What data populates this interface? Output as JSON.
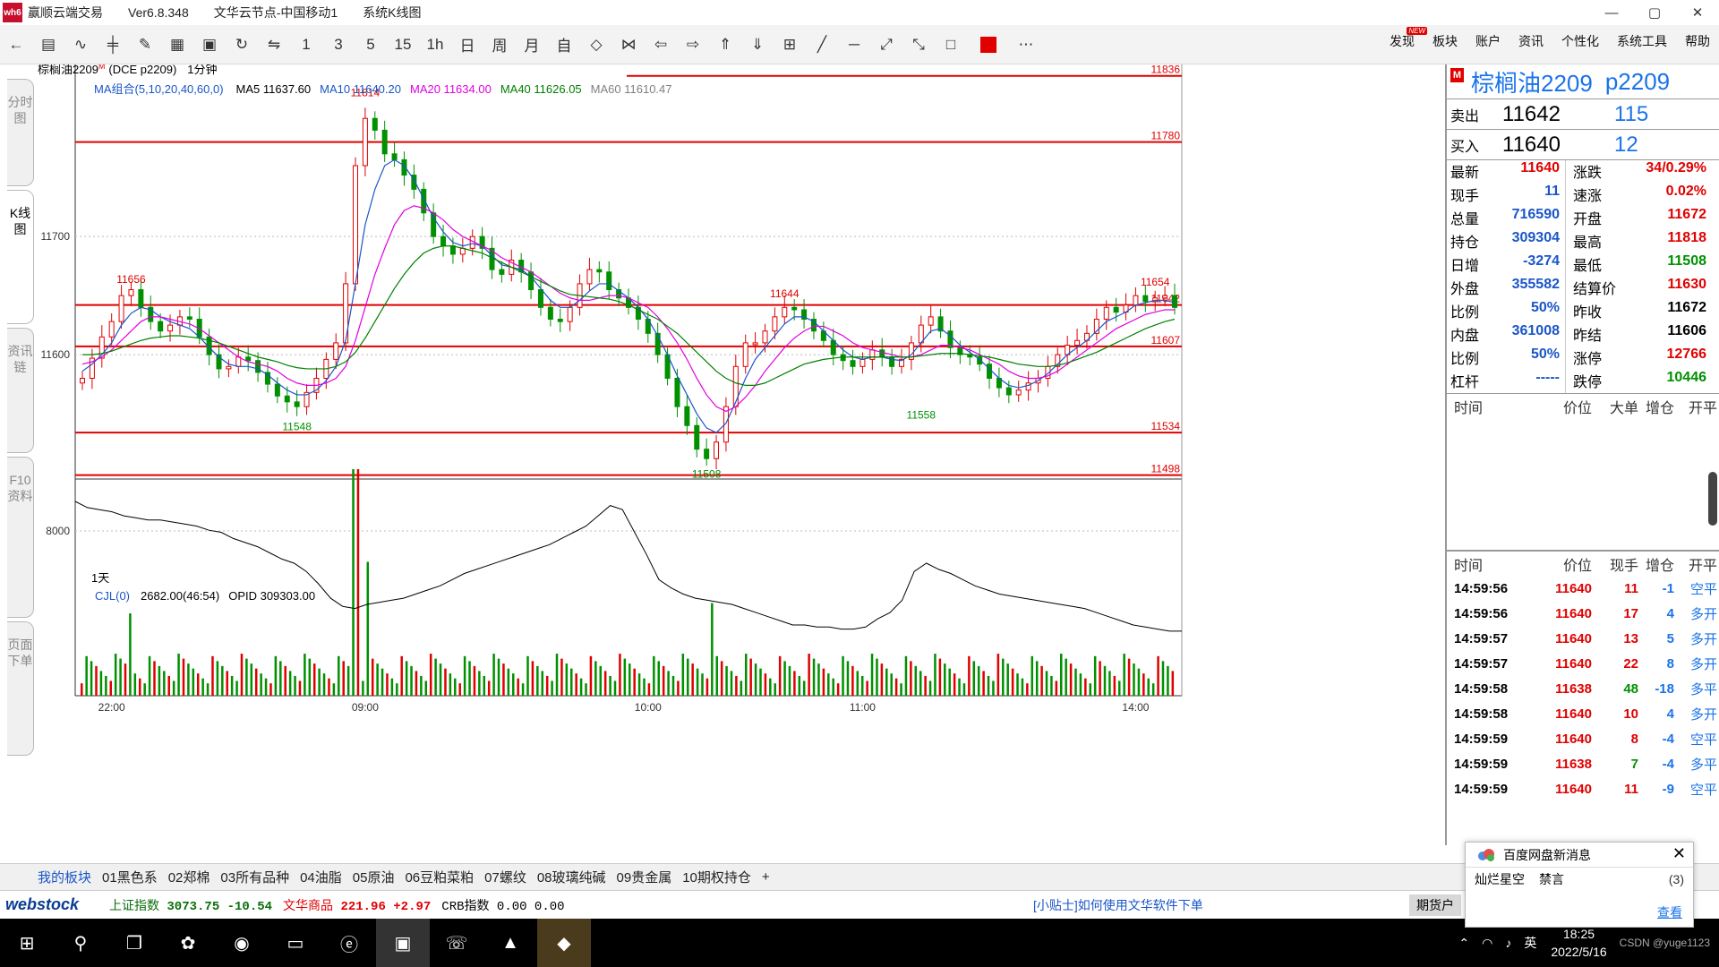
{
  "app": {
    "title": "赢顺云端交易",
    "version": "Ver6.8.348",
    "node": "文华云节点-中国移动1",
    "view": "系统K线图",
    "logo": "wh6"
  },
  "window_controls": [
    "—",
    "▢",
    "✕"
  ],
  "toolbar": {
    "icons": [
      "back-icon",
      "table-icon",
      "line-chart-icon",
      "candle-icon",
      "ma-icon",
      "grid-icon",
      "save-icon",
      "refresh-icon",
      "compare-icon"
    ],
    "periods": [
      "1",
      "3",
      "5",
      "15",
      "1h",
      "日",
      "周",
      "月",
      "自"
    ],
    "right_menu": [
      "发现",
      "板块",
      "账户",
      "资讯",
      "个性化",
      "系统工具",
      "帮助"
    ],
    "new_badge": "NEW"
  },
  "left_tabs": [
    "分时图",
    "K线图",
    "资讯链",
    "F10资料",
    "页面下单"
  ],
  "chart_header": {
    "name": "棕榈油2209",
    "sup": "M",
    "code": "(DCE p2209)",
    "period": "1分钟",
    "ma_group": "MA组合(5,10,20,40,60,0)",
    "ma5": "MA5 11637.60",
    "ma10": "MA10 11640.20",
    "ma20": "MA20 11634.00",
    "ma40": "MA40 11626.05",
    "ma60": "MA60 11610.47"
  },
  "colors": {
    "up": "#e00000",
    "down": "#009000",
    "ma5": "#000000",
    "ma10": "#1a56c8",
    "ma20": "#e000e0",
    "ma40": "#008000",
    "ma60": "#808080",
    "axis": "#333333"
  },
  "chart_data": {
    "type": "candlestick",
    "ylim": [
      11497,
      11832
    ],
    "y_ticks": [
      11600,
      11700
    ],
    "x_labels": [
      "22:00",
      "09:00",
      "10:00",
      "11:00",
      "14:00"
    ],
    "period_label": "1天",
    "h_lines": [
      11836,
      11780,
      11642,
      11607,
      11534,
      11498
    ],
    "annotations": {
      "high": 11814,
      "low": 11508,
      "local": [
        11656,
        11548,
        11644,
        11558,
        11654
      ]
    },
    "close_path": [
      11580,
      11597,
      11615,
      11628,
      11650,
      11655,
      11640,
      11628,
      11620,
      11625,
      11632,
      11630,
      11615,
      11600,
      11588,
      11590,
      11598,
      11595,
      11585,
      11575,
      11565,
      11560,
      11556,
      11568,
      11580,
      11596,
      11610,
      11660,
      11760,
      11800,
      11790,
      11770,
      11765,
      11752,
      11740,
      11720,
      11700,
      11692,
      11685,
      11690,
      11700,
      11690,
      11672,
      11668,
      11680,
      11670,
      11655,
      11640,
      11630,
      11628,
      11640,
      11660,
      11672,
      11670,
      11655,
      11648,
      11640,
      11630,
      11618,
      11600,
      11580,
      11556,
      11540,
      11520,
      11512,
      11526,
      11556,
      11590,
      11610,
      11610,
      11620,
      11632,
      11640,
      11638,
      11630,
      11620,
      11612,
      11600,
      11595,
      11590,
      11596,
      11604,
      11598,
      11590,
      11596,
      11610,
      11625,
      11632,
      11620,
      11606,
      11600,
      11598,
      11592,
      11580,
      11572,
      11566,
      11570,
      11576,
      11580,
      11590,
      11600,
      11608,
      11612,
      11618,
      11630,
      11640,
      11636,
      11642,
      11650,
      11645,
      11648,
      11650,
      11640
    ],
    "ma10_path": [
      11586,
      11592,
      11600,
      11610,
      11625,
      11635,
      11640,
      11638,
      11632,
      11628,
      11625,
      11622,
      11615,
      11606,
      11598,
      11592,
      11590,
      11590,
      11588,
      11583,
      11576,
      11570,
      11566,
      11566,
      11570,
      11578,
      11590,
      11612,
      11660,
      11710,
      11740,
      11760,
      11765,
      11760,
      11748,
      11732,
      11716,
      11704,
      11695,
      11692,
      11694,
      11692,
      11684,
      11676,
      11674,
      11672,
      11666,
      11656,
      11646,
      11640,
      11640,
      11646,
      11654,
      11660,
      11660,
      11654,
      11648,
      11640,
      11630,
      11616,
      11600,
      11582,
      11566,
      11550,
      11538,
      11534,
      11542,
      11560,
      11580,
      11596,
      11606,
      11616,
      11626,
      11632,
      11632,
      11628,
      11620,
      11612,
      11604,
      11598,
      11596,
      11598,
      11598,
      11596,
      11595,
      11600,
      11610,
      11620,
      11622,
      11616,
      11608,
      11602,
      11596,
      11588,
      11580,
      11574,
      11572,
      11574,
      11578,
      11584,
      11592,
      11600,
      11606,
      11612,
      11620,
      11628,
      11632,
      11636,
      11642,
      11644,
      11646,
      11646,
      11644
    ],
    "ma20_path": [
      11592,
      11594,
      11598,
      11604,
      11612,
      11620,
      11628,
      11632,
      11632,
      11630,
      11628,
      11626,
      11622,
      11616,
      11610,
      11604,
      11598,
      11594,
      11592,
      11590,
      11586,
      11580,
      11576,
      11574,
      11574,
      11576,
      11580,
      11590,
      11612,
      11640,
      11668,
      11690,
      11710,
      11722,
      11726,
      11724,
      11720,
      11714,
      11706,
      11700,
      11696,
      11692,
      11688,
      11682,
      11678,
      11674,
      11670,
      11664,
      11658,
      11652,
      11648,
      11646,
      11646,
      11648,
      11650,
      11650,
      11648,
      11644,
      11640,
      11632,
      11622,
      11610,
      11596,
      11580,
      11566,
      11556,
      11552,
      11556,
      11564,
      11574,
      11586,
      11596,
      11606,
      11614,
      11620,
      11624,
      11624,
      11620,
      11616,
      11610,
      11606,
      11604,
      11602,
      11600,
      11598,
      11598,
      11600,
      11604,
      11608,
      11608,
      11606,
      11604,
      11600,
      11596,
      11592,
      11586,
      11582,
      11580,
      11580,
      11582,
      11586,
      11592,
      11598,
      11604,
      11610,
      11616,
      11622,
      11626,
      11630,
      11634,
      11636,
      11638,
      11638
    ],
    "ma40_path": [
      11600,
      11600,
      11601,
      11603,
      11606,
      11609,
      11612,
      11614,
      11615,
      11616,
      11616,
      11615,
      11614,
      11612,
      11610,
      11607,
      11604,
      11601,
      11598,
      11596,
      11594,
      11591,
      11589,
      11588,
      11588,
      11588,
      11590,
      11594,
      11602,
      11614,
      11628,
      11642,
      11656,
      11668,
      11678,
      11686,
      11690,
      11692,
      11692,
      11690,
      11688,
      11686,
      11682,
      11678,
      11674,
      11670,
      11666,
      11662,
      11658,
      11654,
      11651,
      11650,
      11649,
      11648,
      11647,
      11645,
      11642,
      11638,
      11634,
      11630,
      11624,
      11618,
      11610,
      11602,
      11594,
      11586,
      11580,
      11576,
      11574,
      11574,
      11576,
      11580,
      11584,
      11588,
      11592,
      11594,
      11596,
      11597,
      11598,
      11598,
      11598,
      11598,
      11598,
      11598,
      11598,
      11598,
      11599,
      11600,
      11601,
      11601,
      11601,
      11600,
      11599,
      11598,
      11596,
      11594,
      11592,
      11591,
      11590,
      11590,
      11591,
      11593,
      11596,
      11599,
      11602,
      11606,
      11610,
      11614,
      11618,
      11622,
      11625,
      11628,
      11630
    ],
    "vol_label": "CJL(0)",
    "vol_value": "2682.00(46:54)",
    "opid": "OPID 309303.00",
    "vol_tick": "8000"
  },
  "quote": {
    "name": "棕榈油2209",
    "code": "p2209",
    "m_badge": "M",
    "sell_label": "卖出",
    "sell_price": "11642",
    "sell_vol": "115",
    "buy_label": "买入",
    "buy_price": "11640",
    "buy_vol": "12",
    "rows": [
      [
        "最新",
        "11640",
        "涨跌",
        "34/0.29%"
      ],
      [
        "现手",
        "11",
        "速涨",
        "0.02%"
      ],
      [
        "总量",
        "716590",
        "开盘",
        "11672"
      ],
      [
        "持仓",
        "309304",
        "最高",
        "11818"
      ],
      [
        "日增",
        "-3274",
        "最低",
        "11508"
      ],
      [
        "外盘",
        "355582",
        "结算价",
        "11630"
      ],
      [
        "比例",
        "50%",
        "昨收",
        "11672"
      ],
      [
        "内盘",
        "361008",
        "昨结",
        "11606"
      ],
      [
        "比例",
        "50%",
        "涨停",
        "12766"
      ],
      [
        "杠杆",
        "-----",
        "跌停",
        "10446"
      ]
    ]
  },
  "ticks": {
    "header": [
      "时间",
      "价位",
      "现手",
      "增仓",
      "开平"
    ],
    "header1": [
      "时间",
      "价位",
      "大单",
      "增仓",
      "开平"
    ],
    "rows": [
      [
        "14:59:56",
        "11640",
        "11",
        "-1",
        "空平"
      ],
      [
        "14:59:56",
        "11640",
        "17",
        "4",
        "多开"
      ],
      [
        "14:59:57",
        "11640",
        "13",
        "5",
        "多开"
      ],
      [
        "14:59:57",
        "11640",
        "22",
        "8",
        "多开"
      ],
      [
        "14:59:58",
        "11638",
        "48",
        "-18",
        "多平"
      ],
      [
        "14:59:58",
        "11640",
        "10",
        "4",
        "多开"
      ],
      [
        "14:59:59",
        "11640",
        "8",
        "-4",
        "空平"
      ],
      [
        "14:59:59",
        "11638",
        "7",
        "-4",
        "多平"
      ],
      [
        "14:59:59",
        "11640",
        "11",
        "-9",
        "空平"
      ]
    ]
  },
  "bottom_tabs": [
    "我的板块",
    "01黑色系",
    "02郑棉",
    "03所有品种",
    "04油脂",
    "05原油",
    "06豆粕菜粕",
    "07螺纹",
    "08玻璃纯碱",
    "09贵金属",
    "10期权持仓",
    "+"
  ],
  "status": {
    "brand": "webstock",
    "sh_label": "上证指数",
    "sh_value": "3073.75",
    "sh_change": "-10.54",
    "wh_label": "文华商品",
    "wh_value": "221.96",
    "wh_change": "+2.97",
    "crb_label": "CRB指数",
    "crb_value": "0.00 0.00",
    "tip": "[小贴士]如何使用文华软件下单",
    "acct": "期货户"
  },
  "popup": {
    "title": "百度网盘新消息",
    "sender": "灿烂星空",
    "msg": "禁言",
    "count": "(3)",
    "link": "查看"
  },
  "taskbar": {
    "time": "18:25",
    "date": "2022/5/16",
    "ime": "英",
    "watermark": "CSDN @yuge1123"
  }
}
